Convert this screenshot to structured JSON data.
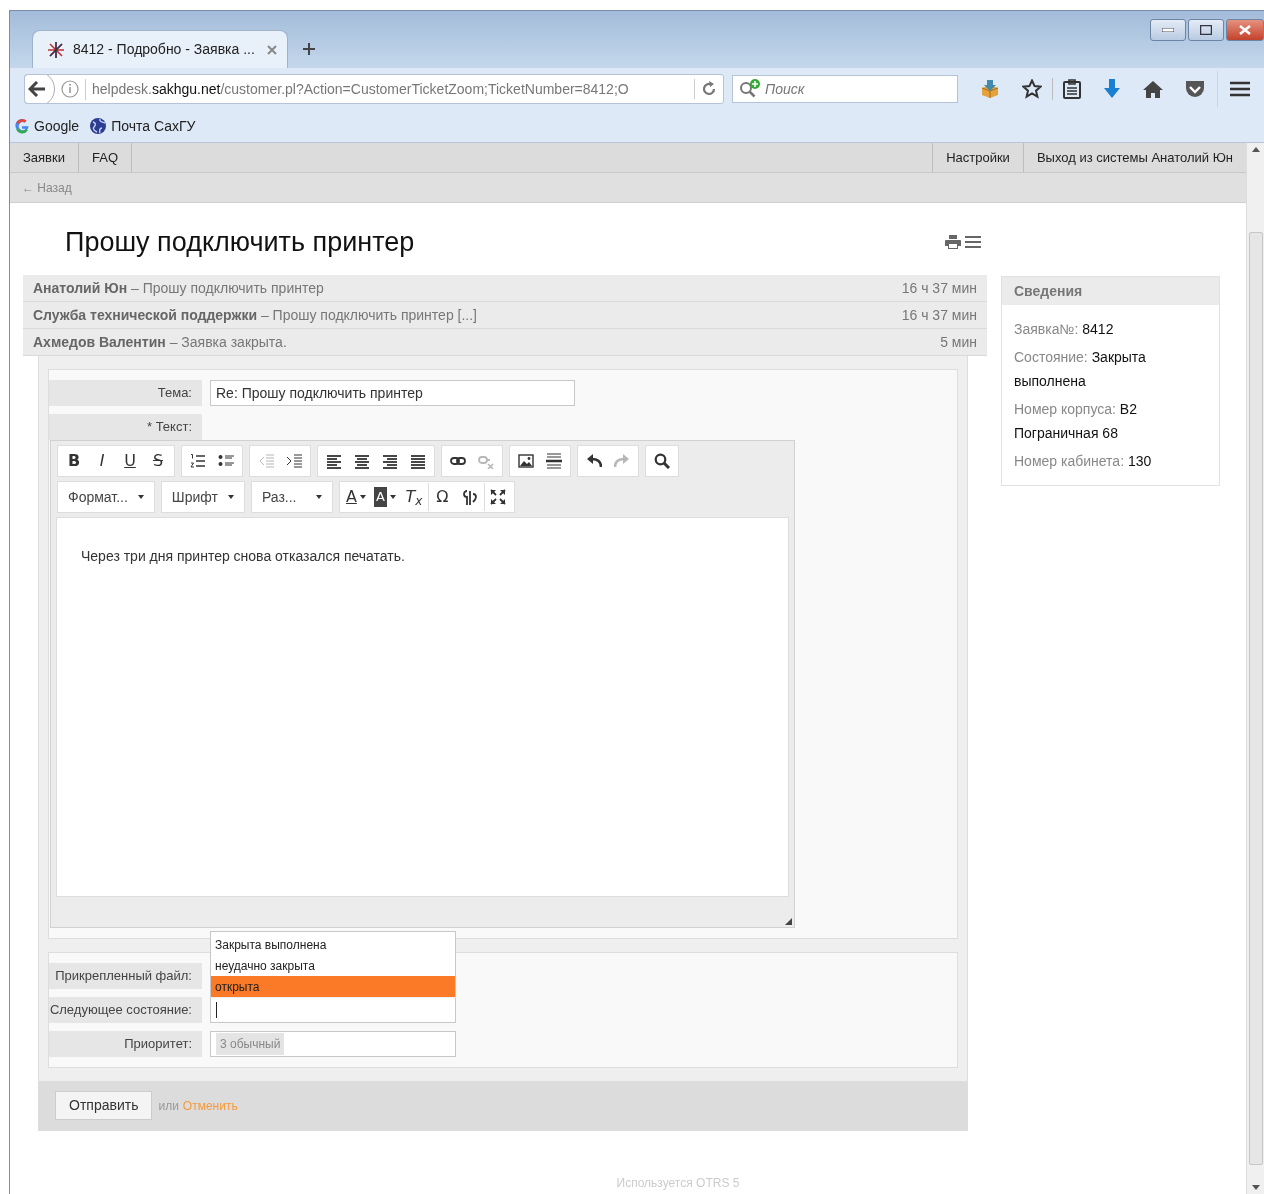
{
  "browser": {
    "tab": {
      "title": "8412 - Подробно - Заявка ...",
      "selected": true
    },
    "url": {
      "prefix": "helpdesk.",
      "domain": "sakhgu.net",
      "path": "/customer.pl?Action=CustomerTicketZoom;TicketNumber=8412;O"
    },
    "search": {
      "placeholder": "Поиск"
    },
    "bookmarks": [
      {
        "label": "Google",
        "kind": "google"
      },
      {
        "label": "Почта СахГУ",
        "kind": "globe"
      }
    ]
  },
  "nav": {
    "left": [
      "Заявки",
      "FAQ"
    ],
    "right": [
      "Настройки",
      "Выход из системы Анатолий Юн"
    ]
  },
  "back_link": "← Назад",
  "ticket_title": "Прошу подключить принтер",
  "articles": [
    {
      "text": "**Анатолий Юн** – Прошу подключить принтер",
      "age": "16 ч 37 мин"
    },
    {
      "text": "**Служба технической поддержки** – Прошу подключить принтер [...]",
      "age": "16 ч 37 мин"
    },
    {
      "text": "**Ахмедов Валентин** – Заявка закрыта.",
      "age": "5 мин"
    }
  ],
  "info": {
    "title": "Сведения",
    "fields": [
      {
        "label": "Заявка№:",
        "value": "8412"
      },
      {
        "label": "Состояние:",
        "value": "Закрыта выполнена"
      },
      {
        "label": "Номер корпуса:",
        "value": "В2 Пограничная 68"
      },
      {
        "label": "Номер кабинета:",
        "value": "130"
      }
    ]
  },
  "form": {
    "subject_label": "Тема:",
    "subject_value": "Re: Прошу подключить принтер",
    "required_mark": "*",
    "text_label": "Текст:",
    "toolbar": [
      [
        [
          {
            "kind": "bold",
            "glyph": "B",
            "disabled": false
          },
          {
            "kind": "italic",
            "glyph": "I",
            "disabled": false
          },
          {
            "kind": "underline",
            "glyph": "U",
            "disabled": false
          },
          {
            "kind": "strike",
            "glyph": "S",
            "disabled": false
          }
        ],
        [
          {
            "kind": "numbered-list",
            "disabled": false
          },
          {
            "kind": "bullet-list",
            "disabled": false
          }
        ],
        [
          {
            "kind": "outdent",
            "disabled": true
          },
          {
            "kind": "indent",
            "disabled": false
          }
        ],
        [
          {
            "kind": "align-left",
            "disabled": false
          },
          {
            "kind": "align-center",
            "disabled": false
          },
          {
            "kind": "align-right",
            "disabled": false
          },
          {
            "kind": "align-justify",
            "disabled": false
          }
        ],
        [
          {
            "kind": "link",
            "disabled": false
          },
          {
            "kind": "unlink",
            "disabled": true
          }
        ],
        [
          {
            "kind": "image",
            "disabled": false
          },
          {
            "kind": "hr",
            "disabled": false
          }
        ],
        [
          {
            "kind": "undo",
            "disabled": false
          },
          {
            "kind": "redo",
            "disabled": true
          }
        ],
        [
          {
            "kind": "search",
            "disabled": false
          }
        ]
      ],
      [
        [
          {
            "kind": "combo",
            "glyph": "Формат...",
            "disabled": false
          }
        ],
        [
          {
            "kind": "combo",
            "glyph": "Шрифт",
            "disabled": false
          }
        ],
        [
          {
            "kind": "combo",
            "glyph": "Раз...",
            "disabled": false
          }
        ],
        [
          {
            "kind": "text-color",
            "glyph": "A",
            "disabled": false
          },
          {
            "kind": "bg-color",
            "glyph": "A",
            "disabled": false
          },
          {
            "kind": "remove-format",
            "glyph": "T$_{x}$",
            "disabled": false
          },
          {
            "kind": "special-char",
            "glyph": "Ω",
            "disabled": false
          },
          {
            "kind": "bidi",
            "disabled": false
          },
          {
            "kind": "maximize",
            "disabled": false
          }
        ]
      ]
    ],
    "body": "Через три дня принтер снова отказался печатать.",
    "attachment_label": "Прикрепленный файл:",
    "state_label": "Следующее состояние:",
    "state_options": [
      {
        "label": "Закрыта выполнена",
        "selected": false
      },
      {
        "label": "неудачно закрыта",
        "selected": false
      },
      {
        "label": "открыта",
        "selected": true
      }
    ],
    "priority_label": "Приоритет:",
    "priority_value": "3 обычный",
    "submit": "Отправить",
    "or_text": "или",
    "cancel": "Отменить"
  },
  "footer": "Используется OTRS 5"
}
